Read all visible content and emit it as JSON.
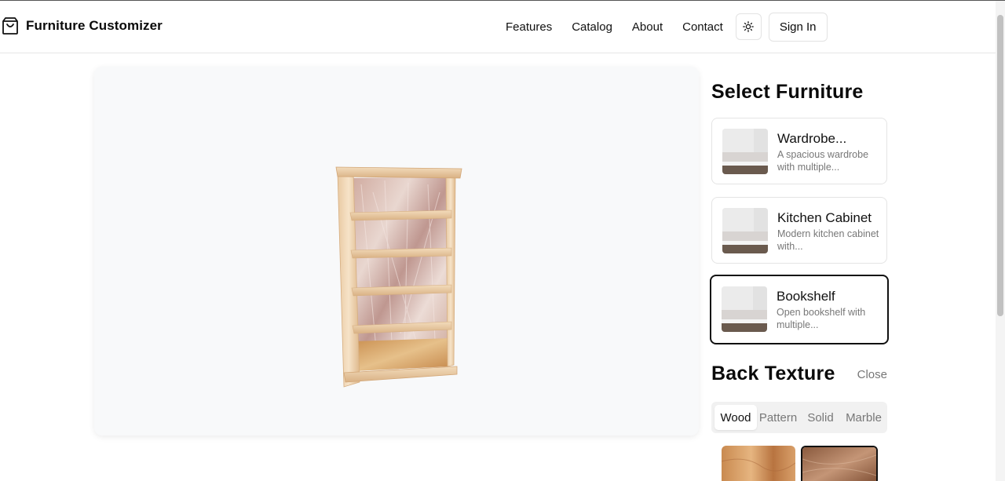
{
  "app": {
    "title": "Furniture Customizer"
  },
  "nav": {
    "links": [
      "Features",
      "Catalog",
      "About",
      "Contact"
    ],
    "sign_in": "Sign In"
  },
  "sidebar": {
    "select_title": "Select Furniture",
    "items": [
      {
        "name": "Wardrobe...",
        "desc": "A spacious wardrobe with multiple..."
      },
      {
        "name": "Kitchen Cabinet",
        "desc": "Modern kitchen cabinet with..."
      },
      {
        "name": "Bookshelf",
        "desc": "Open bookshelf with multiple...",
        "selected": true
      }
    ],
    "texture_title": "Back Texture",
    "close_label": "Close",
    "tabs": [
      "Wood",
      "Pattern",
      "Solid",
      "Marble"
    ],
    "active_tab": "Wood"
  },
  "colors": {
    "accent": "#111111",
    "muted": "#777777",
    "viewer_bg": "#f8f9fa"
  }
}
